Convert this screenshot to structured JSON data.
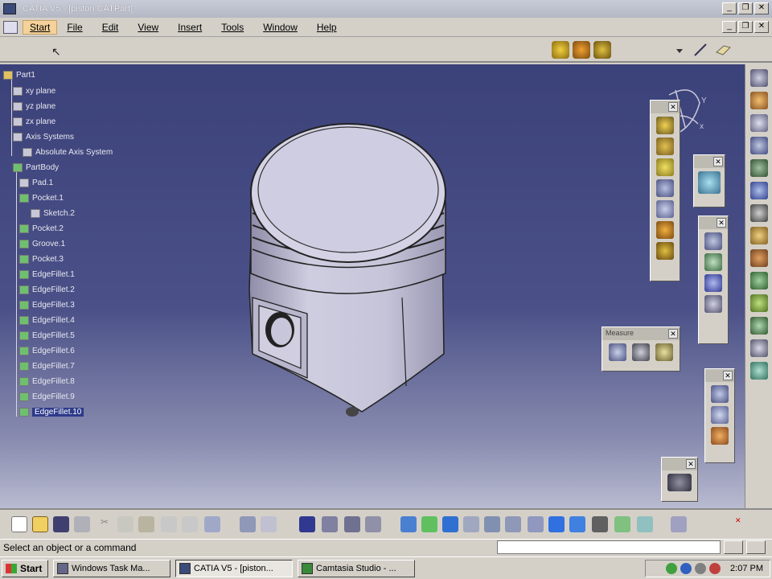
{
  "window": {
    "title": "CATIA V5 - [piston.CATPart]",
    "minimize": "_",
    "restore": "❐",
    "close": "✕"
  },
  "menu": {
    "items": [
      "Start",
      "File",
      "Edit",
      "View",
      "Insert",
      "Tools",
      "Window",
      "Help"
    ]
  },
  "tree": {
    "root": "Part1",
    "nodes": [
      "xy plane",
      "yz plane",
      "zx plane",
      "Axis Systems",
      "Absolute Axis System",
      "PartBody",
      "Pad.1",
      "Pocket.1",
      "Sketch.2",
      "Pocket.2",
      "Groove.1",
      "Pocket.3",
      "EdgeFillet.1",
      "EdgeFillet.2",
      "EdgeFillet.3",
      "EdgeFillet.4",
      "EdgeFillet.5",
      "EdgeFillet.6",
      "EdgeFillet.7",
      "EdgeFillet.8",
      "EdgeFillet.9",
      "EdgeFillet.10"
    ]
  },
  "compass": {
    "axis_y": "Y",
    "axis_x": "x"
  },
  "palettes": {
    "measure_title": "Measure"
  },
  "status": {
    "message": "Select an object or a command"
  },
  "taskbar": {
    "start": "Start",
    "tasks": [
      "Windows Task Ma...",
      "CATIA V5 - [piston...",
      "Camtasia Studio - ..."
    ],
    "clock": "2:07 PM"
  },
  "colors": {
    "viewport_top": "#3b4179",
    "viewport_bottom": "#b9bbd0",
    "part_fill": "#c9c7da",
    "selection": "#2d3a8a"
  }
}
